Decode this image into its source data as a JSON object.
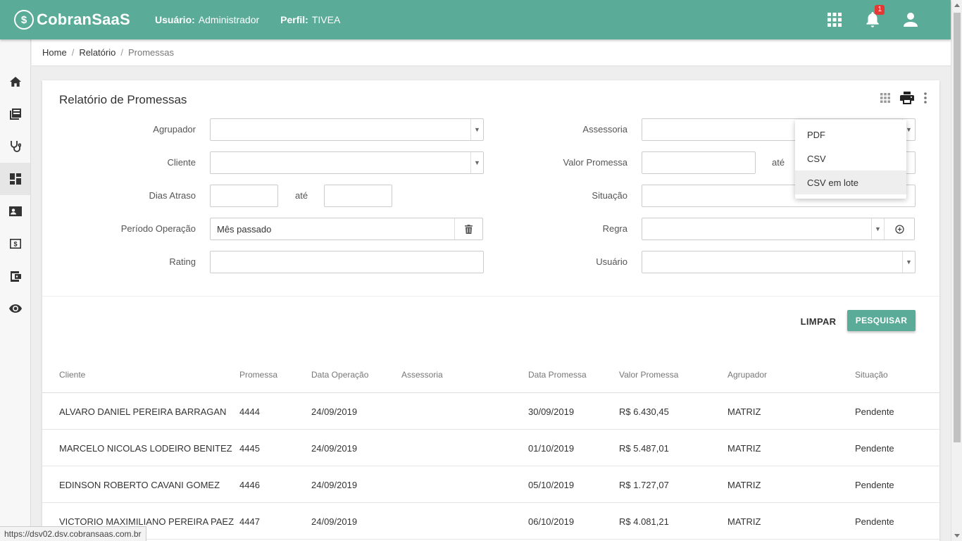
{
  "app": {
    "logo_mark": "$",
    "logo_text": "CobranSaaS"
  },
  "header": {
    "user_label": "Usuário:",
    "user_value": "Administrador",
    "profile_label": "Perfil:",
    "profile_value": "TIVEA",
    "notification_count": "1"
  },
  "breadcrumb": {
    "items": [
      "Home",
      "Relatório",
      "Promessas"
    ],
    "separator": "/"
  },
  "page": {
    "title": "Relatório de Promessas"
  },
  "filters": {
    "agrupador": {
      "label": "Agrupador",
      "value": ""
    },
    "cliente": {
      "label": "Cliente",
      "value": ""
    },
    "dias_atraso": {
      "label": "Dias Atraso",
      "from": "",
      "to": "",
      "between": "até"
    },
    "periodo_operacao": {
      "label": "Período Operação",
      "value": "Mês passado"
    },
    "rating": {
      "label": "Rating",
      "value": ""
    },
    "assessoria": {
      "label": "Assessoria",
      "value": ""
    },
    "valor_promessa": {
      "label": "Valor Promessa",
      "from": "",
      "to": "",
      "between": "até"
    },
    "situacao": {
      "label": "Situação",
      "value": ""
    },
    "regra": {
      "label": "Regra",
      "value": ""
    },
    "usuario": {
      "label": "Usuário",
      "value": ""
    }
  },
  "actions": {
    "clear": "LIMPAR",
    "search": "PESQUISAR"
  },
  "export_menu": {
    "items": [
      "PDF",
      "CSV",
      "CSV em lote"
    ],
    "highlighted": "CSV em lote"
  },
  "table": {
    "columns": [
      "Cliente",
      "Promessa",
      "Data Operação",
      "Assessoria",
      "Data Promessa",
      "Valor Promessa",
      "Agrupador",
      "Situação"
    ],
    "rows": [
      [
        "ALVARO DANIEL PEREIRA BARRAGAN",
        "4444",
        "24/09/2019",
        "",
        "30/09/2019",
        "R$ 6.430,45",
        "MATRIZ",
        "Pendente"
      ],
      [
        "MARCELO NICOLAS LODEIRO BENITEZ",
        "4445",
        "24/09/2019",
        "",
        "01/10/2019",
        "R$ 5.487,01",
        "MATRIZ",
        "Pendente"
      ],
      [
        "EDINSON ROBERTO CAVANI GOMEZ",
        "4446",
        "24/09/2019",
        "",
        "05/10/2019",
        "R$ 1.727,07",
        "MATRIZ",
        "Pendente"
      ],
      [
        "VICTORIO MAXIMILIANO PEREIRA PAEZ",
        "4447",
        "24/09/2019",
        "",
        "06/10/2019",
        "R$ 4.081,21",
        "MATRIZ",
        "Pendente"
      ]
    ]
  },
  "status_url": "https://dsv02.dsv.cobransaas.com.br",
  "colors": {
    "primary": "#5aab98",
    "badge": "#e53935"
  },
  "sidebar_icons": [
    "home-icon",
    "book-icon",
    "stethoscope-icon",
    "dashboard-icon",
    "contact-card-icon",
    "money-icon",
    "wallet-icon",
    "eye-icon"
  ]
}
